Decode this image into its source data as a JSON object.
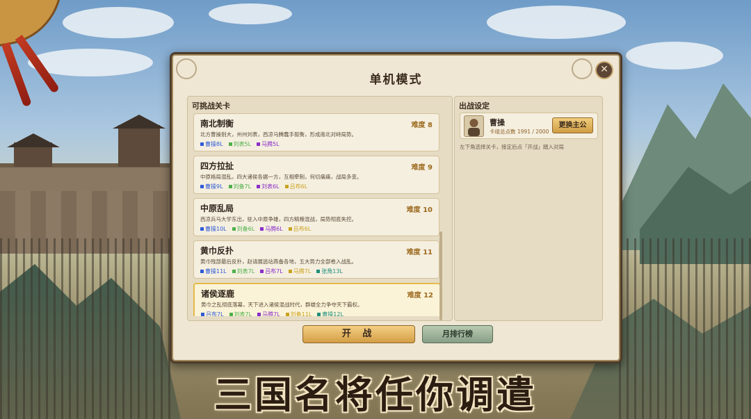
{
  "panel": {
    "title": "单机模式",
    "close_icon": "close-icon"
  },
  "stages_section": {
    "title": "可挑战关卡",
    "stages": [
      {
        "name": "南北制衡",
        "difficulty": "难度 8",
        "desc": "北方曹操割大，州州刘表，西凉马腾蠢手叙衡，形成南北对峙局势。",
        "heroes": [
          {
            "label": "曹操8L",
            "color": "#2f5bd6"
          },
          {
            "label": "刘表5L",
            "color": "#4eb04a"
          },
          {
            "label": "马腾5L",
            "color": "#8a2fc9"
          }
        ]
      },
      {
        "name": "四方拉扯",
        "difficulty": "难度 9",
        "desc": "中原格局混乱，四大诸侯各据一方，互相牵制，何切痛痛，战局多变。",
        "heroes": [
          {
            "label": "曹操9L",
            "color": "#2f5bd6"
          },
          {
            "label": "刘备7L",
            "color": "#4eb04a"
          },
          {
            "label": "刘表6L",
            "color": "#8a2fc9"
          },
          {
            "label": "吕布6L",
            "color": "#c9a21f"
          }
        ]
      },
      {
        "name": "中原乱局",
        "difficulty": "难度 10",
        "desc": "西凉兵马大学东出，驻入中原争雄，四方精粮混战，局势彻底失控。",
        "heroes": [
          {
            "label": "曹操10L",
            "color": "#2f5bd6"
          },
          {
            "label": "刘备6L",
            "color": "#4eb04a"
          },
          {
            "label": "马腾6L",
            "color": "#8a2fc9"
          },
          {
            "label": "吕布6L",
            "color": "#c9a21f"
          }
        ]
      },
      {
        "name": "黄巾反扑",
        "difficulty": "难度 11",
        "desc": "黄巾残部最后反扑，赵请展逃站燕备各地，五大势力全部卷入战乱。",
        "heroes": [
          {
            "label": "曹操11L",
            "color": "#2f5bd6"
          },
          {
            "label": "刘表7L",
            "color": "#4eb04a"
          },
          {
            "label": "吕布7L",
            "color": "#8a2fc9"
          },
          {
            "label": "马腾7L",
            "color": "#c9a21f"
          },
          {
            "label": "张角13L",
            "color": "#1f8f7a"
          }
        ]
      },
      {
        "name": "诸侯逐鹿",
        "difficulty": "难度 12",
        "desc": "黄巾之乱彻底落幕，天下进入诸侯混战时代，群雄全力争夺天下霸权。",
        "heroes": [
          {
            "label": "吕布7L",
            "color": "#2f5bd6"
          },
          {
            "label": "刘表7L",
            "color": "#4eb04a"
          },
          {
            "label": "马腾7L",
            "color": "#8a2fc9"
          },
          {
            "label": "刘备11L",
            "color": "#c9a21f"
          },
          {
            "label": "曹操12L",
            "color": "#1f8f7a"
          }
        ]
      }
    ]
  },
  "deploy": {
    "title": "出战设定",
    "general_name": "曹操",
    "general_stat": "卡组总点数 1991 / 2000",
    "change_button": "更换主公",
    "hint": "左下角选择关卡，接定后点「开战」踏入对局"
  },
  "buttons": {
    "start": "开 战",
    "ranking": "月排行榜"
  },
  "slogan": "三国名将任你调遣",
  "colors": {
    "panel_bg": "#efe7d3",
    "gold_button": "#d49e45",
    "green_button": "#889e86",
    "selected_border": "#e3bb4a"
  }
}
